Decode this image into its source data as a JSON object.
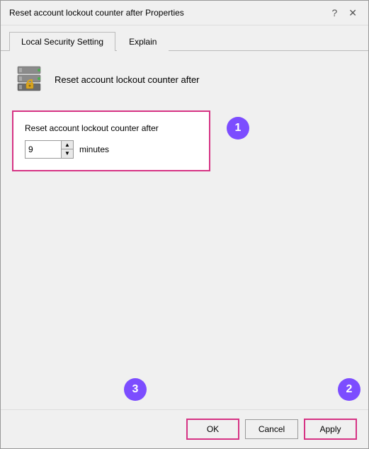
{
  "window": {
    "title": "Reset account lockout counter after Properties",
    "help_btn": "?",
    "close_btn": "✕"
  },
  "tabs": [
    {
      "label": "Local Security Setting",
      "active": true
    },
    {
      "label": "Explain",
      "active": false
    }
  ],
  "policy": {
    "title": "Reset account lockout counter after"
  },
  "settings": {
    "label": "Reset account lockout counter after",
    "value": "9",
    "unit": "minutes"
  },
  "buttons": {
    "ok": "OK",
    "cancel": "Cancel",
    "apply": "Apply"
  },
  "annotations": {
    "one": "1",
    "two": "2",
    "three": "3"
  }
}
